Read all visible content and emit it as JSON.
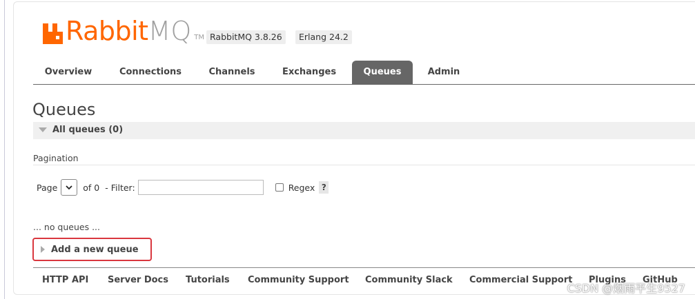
{
  "header": {
    "logo_rabbit": "Rabbit",
    "logo_mq": "MQ",
    "logo_tm": "TM",
    "rabbitmq_version": "RabbitMQ 3.8.26",
    "erlang_version": "Erlang 24.2"
  },
  "nav": {
    "tabs": [
      {
        "label": "Overview"
      },
      {
        "label": "Connections"
      },
      {
        "label": "Channels"
      },
      {
        "label": "Exchanges"
      },
      {
        "label": "Queues",
        "active": true
      },
      {
        "label": "Admin"
      }
    ]
  },
  "main": {
    "title": "Queues",
    "section_title": "All queues (0)",
    "pagination_label": "Pagination",
    "page_label": "Page",
    "of_label": "of 0",
    "filter_label": "- Filter:",
    "filter_value": "",
    "regex_label": "Regex",
    "regex_checked": false,
    "help_label": "?",
    "empty_text": "... no queues ...",
    "add_queue_label": "Add a new queue"
  },
  "footer": {
    "links": [
      {
        "label": "HTTP API"
      },
      {
        "label": "Server Docs"
      },
      {
        "label": "Tutorials"
      },
      {
        "label": "Community Support"
      },
      {
        "label": "Community Slack"
      },
      {
        "label": "Commercial Support"
      },
      {
        "label": "Plugins"
      },
      {
        "label": "GitHub"
      }
    ]
  },
  "watermark": "CSDN @烟雨平生9527",
  "colors": {
    "brand_orange": "#ff6600",
    "active_tab": "#666666",
    "highlight_border": "#d9363e"
  }
}
